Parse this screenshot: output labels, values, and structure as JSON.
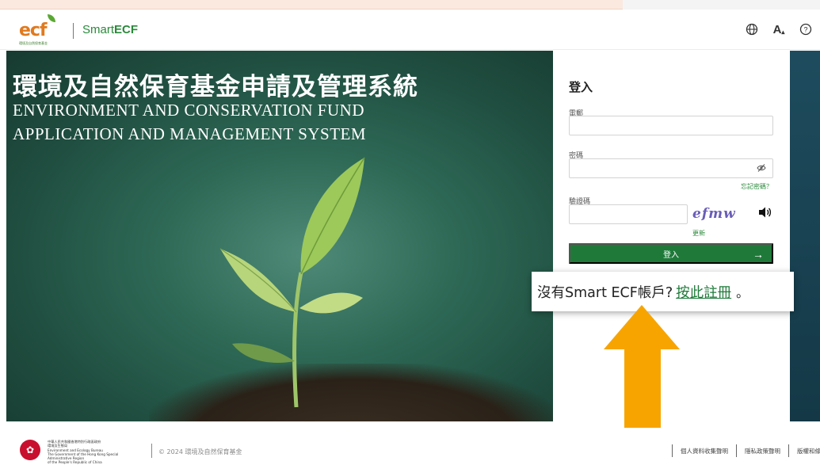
{
  "header": {
    "logo_text": "ecf",
    "logo_sub": "環境及自然保育基金",
    "brand_prefix": "Smart",
    "brand_suffix": "ECF",
    "icons": [
      "globe-icon",
      "font-size-icon",
      "help-icon"
    ],
    "font_size_label": "A"
  },
  "hero": {
    "title_zh": "環境及自然保育基金申請及管理系統",
    "title_en_line1": "ENVIRONMENT AND CONSERVATION FUND",
    "title_en_line2": "APPLICATION AND MANAGEMENT SYSTEM"
  },
  "login": {
    "title": "登入",
    "email_label": "電郵",
    "email_value": "",
    "password_label": "密碼",
    "password_value": "",
    "forgot_password": "忘記密碼？",
    "captcha_label": "驗證碼",
    "captcha_value": "",
    "captcha_text": "efmw",
    "refresh_label": "更新",
    "submit_label": "登入",
    "submit_arrow": "→"
  },
  "callout": {
    "text": "沒有Smart ECF帳戶?",
    "link": "按此註冊",
    "suffix": "。"
  },
  "footer": {
    "gov_line1": "中華人民共和國香港特別行政區政府",
    "gov_line2": "環境及生態局",
    "gov_line3": "Environment and Ecology Bureau",
    "gov_line4": "The Government of the Hong Kong Special Administrative Region",
    "gov_line5": "of the People's Republic of China",
    "copyright": "© 2024 環境及自然保育基金",
    "links": [
      "個人資料收集聲明",
      "隱私政策聲明",
      "版權和條件"
    ]
  },
  "colors": {
    "brand_green": "#1f7a3a",
    "logo_orange": "#e07a1f",
    "arrow_orange": "#f7a400"
  }
}
